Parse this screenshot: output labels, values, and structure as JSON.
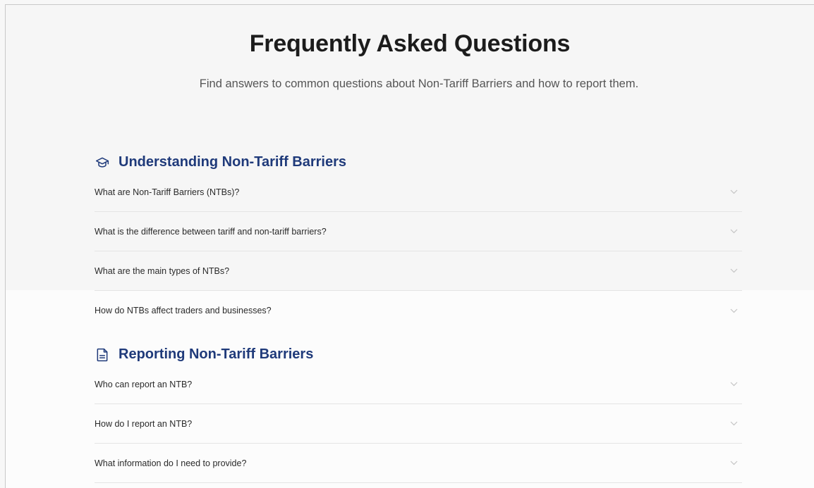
{
  "header": {
    "title": "Frequently Asked Questions",
    "subtitle": "Find answers to common questions about Non-Tariff Barriers and how to report them."
  },
  "sections": [
    {
      "heading": "Understanding Non-Tariff Barriers",
      "icon": "graduation-cap-icon",
      "items": [
        {
          "question": "What are Non-Tariff Barriers (NTBs)?"
        },
        {
          "question": "What is the difference between tariff and non-tariff barriers?"
        },
        {
          "question": "What are the main types of NTBs?"
        },
        {
          "question": "How do NTBs affect traders and businesses?"
        }
      ]
    },
    {
      "heading": "Reporting Non-Tariff Barriers",
      "icon": "document-icon",
      "items": [
        {
          "question": "Who can report an NTB?"
        },
        {
          "question": "How do I report an NTB?"
        },
        {
          "question": "What information do I need to provide?"
        }
      ]
    }
  ],
  "colors": {
    "heading": "#1f3a7a",
    "title": "#1c1c1c",
    "divider": "#e4e4e4"
  }
}
